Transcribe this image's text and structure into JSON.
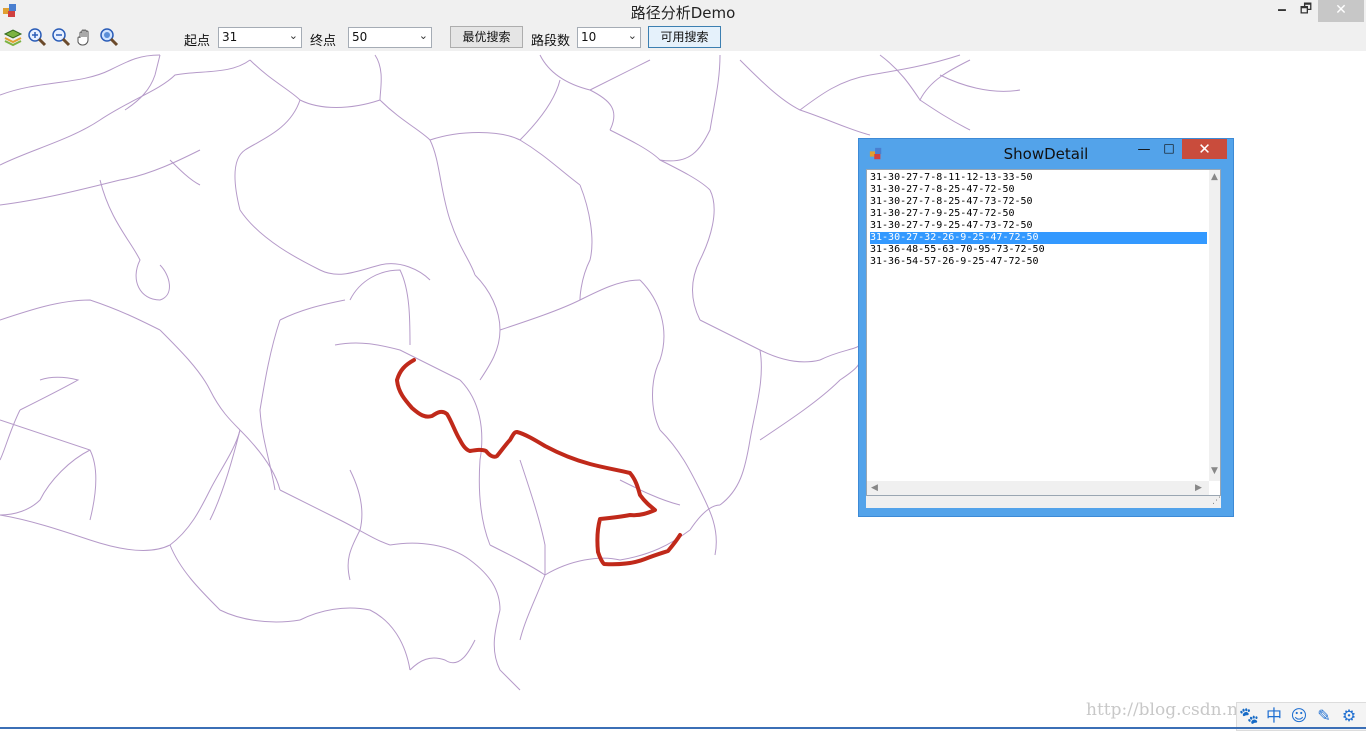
{
  "window": {
    "title": "路径分析Demo",
    "minimize": "🗕",
    "maximize": "🗗",
    "close": "✕"
  },
  "toolbar": {
    "icons": [
      "layers-icon",
      "zoom-in-icon",
      "zoom-out-icon",
      "pan-hand-icon",
      "full-extent-icon"
    ],
    "start_label": "起点",
    "start_value": "31",
    "end_label": "终点",
    "end_value": "50",
    "best_search_label": "最优搜索",
    "segments_label": "路段数",
    "segments_value": "10",
    "available_search_label": "可用搜索"
  },
  "map": {
    "road_color": "#b59ac9",
    "route_color": "#c0291a"
  },
  "dialog": {
    "title": "ShowDetail",
    "minimize": "—",
    "maximize": "□",
    "close": "✕",
    "paths": [
      "31-30-27-7-8-11-12-13-33-50",
      "31-30-27-7-8-25-47-72-50",
      "31-30-27-7-8-25-47-73-72-50",
      "31-30-27-7-9-25-47-72-50",
      "31-30-27-7-9-25-47-73-72-50",
      "31-30-27-32-26-9-25-47-72-50",
      "31-36-48-55-63-70-95-73-72-50",
      "31-36-54-57-26-9-25-47-72-50"
    ],
    "selected_index": 5
  },
  "watermark": "http://blog.csdn.net/dewdw",
  "tray": {
    "icons": [
      "paw-icon",
      "chinese-ime-icon",
      "smiley-icon",
      "pen-icon",
      "settings-icon"
    ],
    "ime_label": "中"
  }
}
